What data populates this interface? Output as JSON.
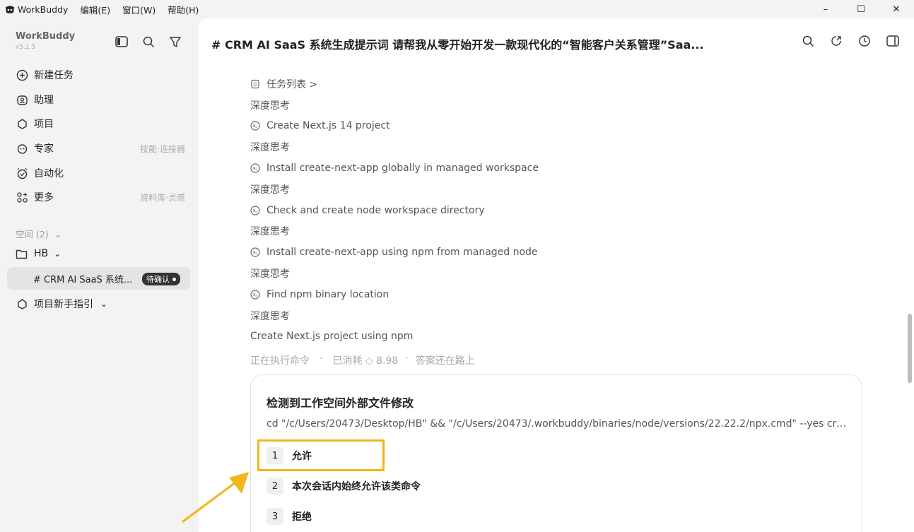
{
  "menubar": {
    "app_name": "WorkBuddy",
    "menus": [
      "编辑(E)",
      "窗口(W)",
      "帮助(H)"
    ],
    "window_controls": [
      "–",
      "☐",
      "✕"
    ]
  },
  "sidebar": {
    "brand": "WorkBuddy",
    "version": "v5.1.5",
    "nav": [
      {
        "label": "新建任务",
        "icon": "plus-circle-icon",
        "hint": ""
      },
      {
        "label": "助理",
        "icon": "assistant-icon",
        "hint": ""
      },
      {
        "label": "项目",
        "icon": "project-icon",
        "hint": ""
      },
      {
        "label": "专家",
        "icon": "expert-icon",
        "hint": "技能·连接器"
      },
      {
        "label": "自动化",
        "icon": "alarm-icon",
        "hint": ""
      },
      {
        "label": "更多",
        "icon": "more-icon",
        "hint": "资料库·灵感"
      }
    ],
    "space_label": "空间 (2)",
    "project": "HB",
    "session_title": "# CRM AI SaaS 系统...",
    "session_badge": "待确认",
    "guide": "项目新手指引"
  },
  "main": {
    "title": "# CRM AI SaaS 系统生成提示词 请帮我从零开始开发一款现代化的“智能客户关系管理”Saa...",
    "stream": [
      {
        "text": "任务列表  >",
        "icon": "tasklist-icon"
      },
      {
        "text": "深度思考",
        "icon": ""
      },
      {
        "text": "Create Next.js 14 project",
        "icon": "terminal-icon"
      },
      {
        "text": "深度思考",
        "icon": ""
      },
      {
        "text": "Install create-next-app globally in managed workspace",
        "icon": "terminal-icon"
      },
      {
        "text": "深度思考",
        "icon": ""
      },
      {
        "text": "Check and create node workspace directory",
        "icon": "terminal-icon"
      },
      {
        "text": "深度思考",
        "icon": ""
      },
      {
        "text": "Install create-next-app using npm from managed node",
        "icon": "terminal-icon"
      },
      {
        "text": "深度思考",
        "icon": ""
      },
      {
        "text": "Find npm binary location",
        "icon": "terminal-icon"
      },
      {
        "text": "深度思考",
        "icon": ""
      },
      {
        "text": "Create Next.js project using npm",
        "icon": ""
      }
    ],
    "status": {
      "running": "正在执行命令",
      "consumed": "已消耗 ◇ 8.98",
      "pending": "答案还在路上"
    },
    "card": {
      "title": "检测到工作空间外部文件修改",
      "command": "cd \"/c/Users/20473/Desktop/HB\" && \"/c/Users/20473/.workbuddy/binaries/node/versions/22.22.2/npx.cmd\" --yes create...",
      "options": [
        {
          "num": "1",
          "label": "允许"
        },
        {
          "num": "2",
          "label": "本次会话内始终允许该类命令"
        },
        {
          "num": "3",
          "label": "拒绝"
        }
      ]
    },
    "accent_color": "#f2b51c"
  }
}
